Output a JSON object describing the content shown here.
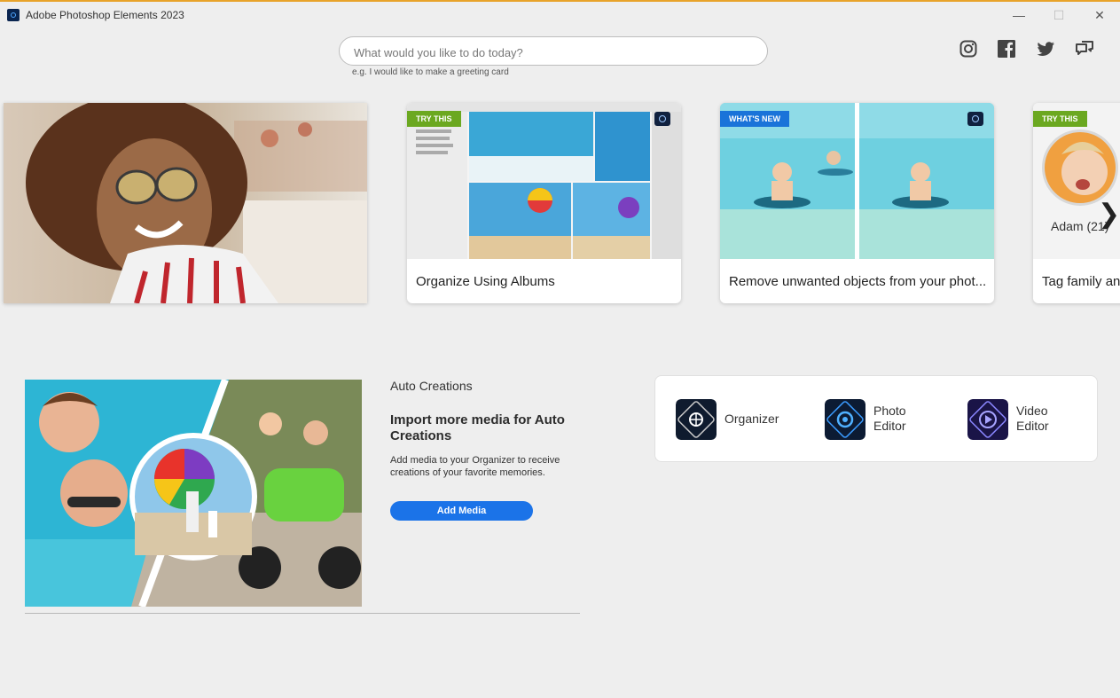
{
  "window": {
    "title": "Adobe Photoshop Elements 2023",
    "minimize": "—",
    "maximize": "☐",
    "close": "✕"
  },
  "search": {
    "placeholder": "What would you like to do today?",
    "value": "",
    "hint": "e.g. I would like to make a greeting card"
  },
  "social": [
    "instagram-icon",
    "facebook-icon",
    "twitter-icon",
    "feedback-icon"
  ],
  "carousel": {
    "cards": [
      {
        "tag": "TRY THIS",
        "label": "Organize Using Albums"
      },
      {
        "tag": "WHAT'S NEW",
        "label": "Remove unwanted objects from your phot..."
      },
      {
        "tag": "TRY THIS",
        "label": "Tag family an",
        "person": "Adam (21)"
      }
    ],
    "next": "❯"
  },
  "auto_creations": {
    "title": "Auto Creations",
    "heading": "Import more media for Auto Creations",
    "description": "Add media to your Organizer to receive creations of your favorite memories.",
    "button": "Add Media"
  },
  "launcher": {
    "organizer": "Organizer",
    "photo_editor": "Photo Editor",
    "video_editor": "Video Editor"
  },
  "colors": {
    "accent": "#1b73e8",
    "try_this": "#6ba820",
    "whats_new": "#1a73d9",
    "top_border": "#e8a32a"
  }
}
